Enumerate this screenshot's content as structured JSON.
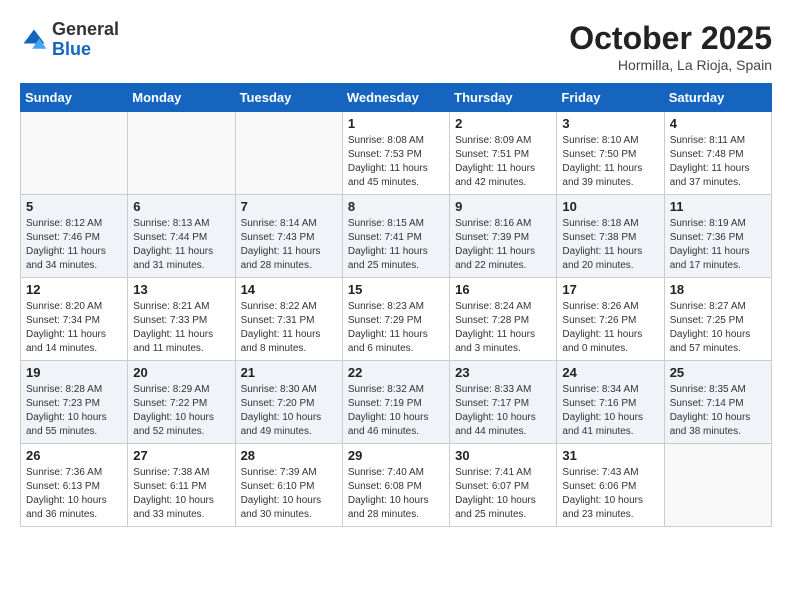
{
  "header": {
    "logo_general": "General",
    "logo_blue": "Blue",
    "month": "October 2025",
    "location": "Hormilla, La Rioja, Spain"
  },
  "weekdays": [
    "Sunday",
    "Monday",
    "Tuesday",
    "Wednesday",
    "Thursday",
    "Friday",
    "Saturday"
  ],
  "weeks": [
    [
      {
        "day": "",
        "info": ""
      },
      {
        "day": "",
        "info": ""
      },
      {
        "day": "",
        "info": ""
      },
      {
        "day": "1",
        "info": "Sunrise: 8:08 AM\nSunset: 7:53 PM\nDaylight: 11 hours and 45 minutes."
      },
      {
        "day": "2",
        "info": "Sunrise: 8:09 AM\nSunset: 7:51 PM\nDaylight: 11 hours and 42 minutes."
      },
      {
        "day": "3",
        "info": "Sunrise: 8:10 AM\nSunset: 7:50 PM\nDaylight: 11 hours and 39 minutes."
      },
      {
        "day": "4",
        "info": "Sunrise: 8:11 AM\nSunset: 7:48 PM\nDaylight: 11 hours and 37 minutes."
      }
    ],
    [
      {
        "day": "5",
        "info": "Sunrise: 8:12 AM\nSunset: 7:46 PM\nDaylight: 11 hours and 34 minutes."
      },
      {
        "day": "6",
        "info": "Sunrise: 8:13 AM\nSunset: 7:44 PM\nDaylight: 11 hours and 31 minutes."
      },
      {
        "day": "7",
        "info": "Sunrise: 8:14 AM\nSunset: 7:43 PM\nDaylight: 11 hours and 28 minutes."
      },
      {
        "day": "8",
        "info": "Sunrise: 8:15 AM\nSunset: 7:41 PM\nDaylight: 11 hours and 25 minutes."
      },
      {
        "day": "9",
        "info": "Sunrise: 8:16 AM\nSunset: 7:39 PM\nDaylight: 11 hours and 22 minutes."
      },
      {
        "day": "10",
        "info": "Sunrise: 8:18 AM\nSunset: 7:38 PM\nDaylight: 11 hours and 20 minutes."
      },
      {
        "day": "11",
        "info": "Sunrise: 8:19 AM\nSunset: 7:36 PM\nDaylight: 11 hours and 17 minutes."
      }
    ],
    [
      {
        "day": "12",
        "info": "Sunrise: 8:20 AM\nSunset: 7:34 PM\nDaylight: 11 hours and 14 minutes."
      },
      {
        "day": "13",
        "info": "Sunrise: 8:21 AM\nSunset: 7:33 PM\nDaylight: 11 hours and 11 minutes."
      },
      {
        "day": "14",
        "info": "Sunrise: 8:22 AM\nSunset: 7:31 PM\nDaylight: 11 hours and 8 minutes."
      },
      {
        "day": "15",
        "info": "Sunrise: 8:23 AM\nSunset: 7:29 PM\nDaylight: 11 hours and 6 minutes."
      },
      {
        "day": "16",
        "info": "Sunrise: 8:24 AM\nSunset: 7:28 PM\nDaylight: 11 hours and 3 minutes."
      },
      {
        "day": "17",
        "info": "Sunrise: 8:26 AM\nSunset: 7:26 PM\nDaylight: 11 hours and 0 minutes."
      },
      {
        "day": "18",
        "info": "Sunrise: 8:27 AM\nSunset: 7:25 PM\nDaylight: 10 hours and 57 minutes."
      }
    ],
    [
      {
        "day": "19",
        "info": "Sunrise: 8:28 AM\nSunset: 7:23 PM\nDaylight: 10 hours and 55 minutes."
      },
      {
        "day": "20",
        "info": "Sunrise: 8:29 AM\nSunset: 7:22 PM\nDaylight: 10 hours and 52 minutes."
      },
      {
        "day": "21",
        "info": "Sunrise: 8:30 AM\nSunset: 7:20 PM\nDaylight: 10 hours and 49 minutes."
      },
      {
        "day": "22",
        "info": "Sunrise: 8:32 AM\nSunset: 7:19 PM\nDaylight: 10 hours and 46 minutes."
      },
      {
        "day": "23",
        "info": "Sunrise: 8:33 AM\nSunset: 7:17 PM\nDaylight: 10 hours and 44 minutes."
      },
      {
        "day": "24",
        "info": "Sunrise: 8:34 AM\nSunset: 7:16 PM\nDaylight: 10 hours and 41 minutes."
      },
      {
        "day": "25",
        "info": "Sunrise: 8:35 AM\nSunset: 7:14 PM\nDaylight: 10 hours and 38 minutes."
      }
    ],
    [
      {
        "day": "26",
        "info": "Sunrise: 7:36 AM\nSunset: 6:13 PM\nDaylight: 10 hours and 36 minutes."
      },
      {
        "day": "27",
        "info": "Sunrise: 7:38 AM\nSunset: 6:11 PM\nDaylight: 10 hours and 33 minutes."
      },
      {
        "day": "28",
        "info": "Sunrise: 7:39 AM\nSunset: 6:10 PM\nDaylight: 10 hours and 30 minutes."
      },
      {
        "day": "29",
        "info": "Sunrise: 7:40 AM\nSunset: 6:08 PM\nDaylight: 10 hours and 28 minutes."
      },
      {
        "day": "30",
        "info": "Sunrise: 7:41 AM\nSunset: 6:07 PM\nDaylight: 10 hours and 25 minutes."
      },
      {
        "day": "31",
        "info": "Sunrise: 7:43 AM\nSunset: 6:06 PM\nDaylight: 10 hours and 23 minutes."
      },
      {
        "day": "",
        "info": ""
      }
    ]
  ]
}
